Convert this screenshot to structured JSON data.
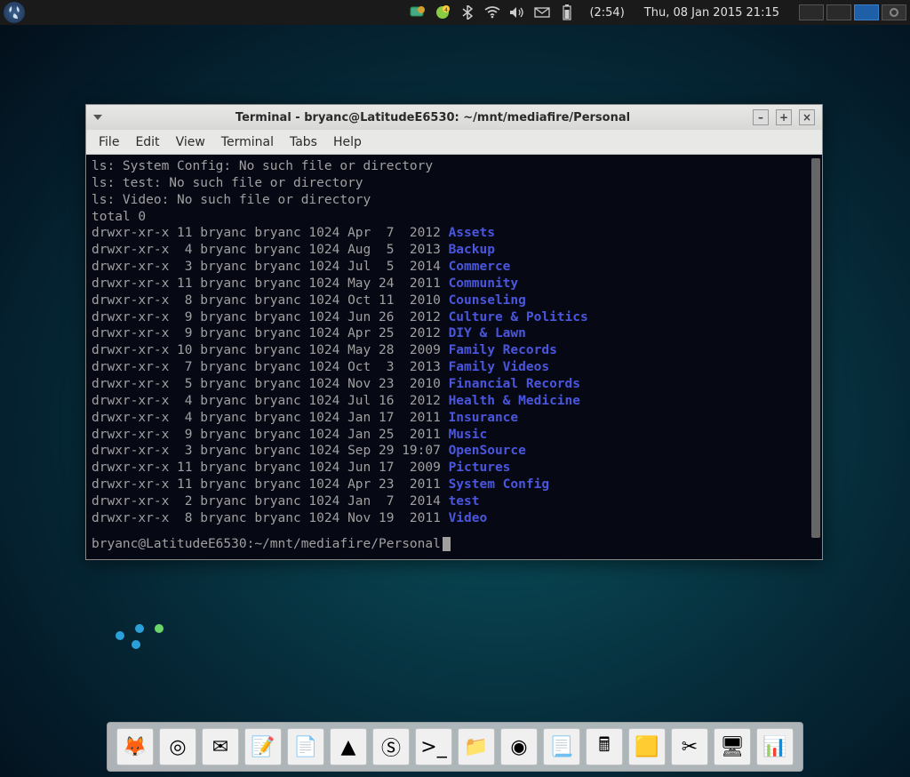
{
  "panel": {
    "time": "(2:54)",
    "date": "Thu, 08 Jan 2015 21:15"
  },
  "terminal": {
    "title": "Terminal - bryanc@LatitudeE6530: ~/mnt/mediafire/Personal",
    "menu": [
      "File",
      "Edit",
      "View",
      "Terminal",
      "Tabs",
      "Help"
    ],
    "errors": [
      "ls: System Config: No such file or directory",
      "ls: test: No such file or directory",
      "ls: Video: No such file or directory"
    ],
    "total_line": "total 0",
    "listing": [
      {
        "perms": "drwxr-xr-x",
        "links": "11",
        "user": "bryanc",
        "group": "bryanc",
        "size": "1024",
        "date": "Apr  7  2012",
        "name": "Assets"
      },
      {
        "perms": "drwxr-xr-x",
        "links": " 4",
        "user": "bryanc",
        "group": "bryanc",
        "size": "1024",
        "date": "Aug  5  2013",
        "name": "Backup"
      },
      {
        "perms": "drwxr-xr-x",
        "links": " 3",
        "user": "bryanc",
        "group": "bryanc",
        "size": "1024",
        "date": "Jul  5  2014",
        "name": "Commerce"
      },
      {
        "perms": "drwxr-xr-x",
        "links": "11",
        "user": "bryanc",
        "group": "bryanc",
        "size": "1024",
        "date": "May 24  2011",
        "name": "Community"
      },
      {
        "perms": "drwxr-xr-x",
        "links": " 8",
        "user": "bryanc",
        "group": "bryanc",
        "size": "1024",
        "date": "Oct 11  2010",
        "name": "Counseling"
      },
      {
        "perms": "drwxr-xr-x",
        "links": " 9",
        "user": "bryanc",
        "group": "bryanc",
        "size": "1024",
        "date": "Jun 26  2012",
        "name": "Culture & Politics"
      },
      {
        "perms": "drwxr-xr-x",
        "links": " 9",
        "user": "bryanc",
        "group": "bryanc",
        "size": "1024",
        "date": "Apr 25  2012",
        "name": "DIY & Lawn"
      },
      {
        "perms": "drwxr-xr-x",
        "links": "10",
        "user": "bryanc",
        "group": "bryanc",
        "size": "1024",
        "date": "May 28  2009",
        "name": "Family Records"
      },
      {
        "perms": "drwxr-xr-x",
        "links": " 7",
        "user": "bryanc",
        "group": "bryanc",
        "size": "1024",
        "date": "Oct  3  2013",
        "name": "Family Videos"
      },
      {
        "perms": "drwxr-xr-x",
        "links": " 5",
        "user": "bryanc",
        "group": "bryanc",
        "size": "1024",
        "date": "Nov 23  2010",
        "name": "Financial Records"
      },
      {
        "perms": "drwxr-xr-x",
        "links": " 4",
        "user": "bryanc",
        "group": "bryanc",
        "size": "1024",
        "date": "Jul 16  2012",
        "name": "Health & Medicine"
      },
      {
        "perms": "drwxr-xr-x",
        "links": " 4",
        "user": "bryanc",
        "group": "bryanc",
        "size": "1024",
        "date": "Jan 17  2011",
        "name": "Insurance"
      },
      {
        "perms": "drwxr-xr-x",
        "links": " 9",
        "user": "bryanc",
        "group": "bryanc",
        "size": "1024",
        "date": "Jan 25  2011",
        "name": "Music"
      },
      {
        "perms": "drwxr-xr-x",
        "links": " 3",
        "user": "bryanc",
        "group": "bryanc",
        "size": "1024",
        "date": "Sep 29 19:07",
        "name": "OpenSource"
      },
      {
        "perms": "drwxr-xr-x",
        "links": "11",
        "user": "bryanc",
        "group": "bryanc",
        "size": "1024",
        "date": "Jun 17  2009",
        "name": "Pictures"
      },
      {
        "perms": "drwxr-xr-x",
        "links": "11",
        "user": "bryanc",
        "group": "bryanc",
        "size": "1024",
        "date": "Apr 23  2011",
        "name": "System Config"
      },
      {
        "perms": "drwxr-xr-x",
        "links": " 2",
        "user": "bryanc",
        "group": "bryanc",
        "size": "1024",
        "date": "Jan  7  2014",
        "name": "test"
      },
      {
        "perms": "drwxr-xr-x",
        "links": " 8",
        "user": "bryanc",
        "group": "bryanc",
        "size": "1024",
        "date": "Nov 19  2011",
        "name": "Video"
      }
    ],
    "prompt": "bryanc@LatitudeE6530:~/mnt/mediafire/Personal"
  },
  "dock": {
    "items": [
      {
        "name": "firefox-icon",
        "glyph": "🦊"
      },
      {
        "name": "chromium-icon",
        "glyph": "◎"
      },
      {
        "name": "mail-icon",
        "glyph": "✉"
      },
      {
        "name": "editor-icon",
        "glyph": "📝"
      },
      {
        "name": "notes-icon",
        "glyph": "📄"
      },
      {
        "name": "vlc-icon",
        "glyph": "▲"
      },
      {
        "name": "skype-icon",
        "glyph": "Ⓢ"
      },
      {
        "name": "terminal-icon",
        "glyph": ">_"
      },
      {
        "name": "filemanager-icon",
        "glyph": "📁"
      },
      {
        "name": "disk-icon",
        "glyph": "◉"
      },
      {
        "name": "text-icon",
        "glyph": "📃"
      },
      {
        "name": "calculator-icon",
        "glyph": "🖩"
      },
      {
        "name": "stickynote-icon",
        "glyph": "🟨"
      },
      {
        "name": "tools-icon",
        "glyph": "✂"
      },
      {
        "name": "display-icon",
        "glyph": "🖥"
      },
      {
        "name": "monitor-icon",
        "glyph": "📊"
      }
    ]
  }
}
